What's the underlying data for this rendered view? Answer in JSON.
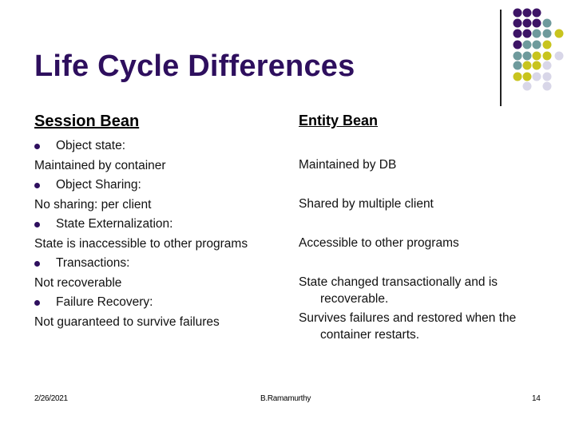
{
  "slide": {
    "title": "Life Cycle Differences",
    "session_heading": "Session Bean",
    "entity_heading": "Entity Bean",
    "session_items": [
      {
        "label": "Object state:",
        "value": "Maintained by container"
      },
      {
        "label": "Object Sharing:",
        "value": "No sharing: per client"
      },
      {
        "label": "State Externalization:",
        "value": "State is inaccessible to other programs"
      },
      {
        "label": "Transactions:",
        "value": "Not recoverable"
      },
      {
        "label": "Failure Recovery:",
        "value": "Not guaranteed to survive failures"
      }
    ],
    "entity_items": [
      {
        "line1": "Maintained by DB",
        "line2": ""
      },
      {
        "line1": "Shared by multiple client",
        "line2": ""
      },
      {
        "line1": "Accessible to other programs",
        "line2": ""
      },
      {
        "line1": "State changed transactionally and is",
        "line2": "recoverable."
      },
      {
        "line1": "Survives failures and restored when the",
        "line2": "container restarts."
      }
    ],
    "bullet_icon": "filled-circle"
  },
  "footer": {
    "date": "2/26/2021",
    "author": "B.Ramamurthy",
    "page_number": "14"
  },
  "theme": {
    "title_color": "#2e0f5e",
    "dot_colors": {
      "purple": "#3d1466",
      "teal": "#6e9a9c",
      "olive": "#c8c41e",
      "lavender": "#d8d6e8"
    }
  }
}
